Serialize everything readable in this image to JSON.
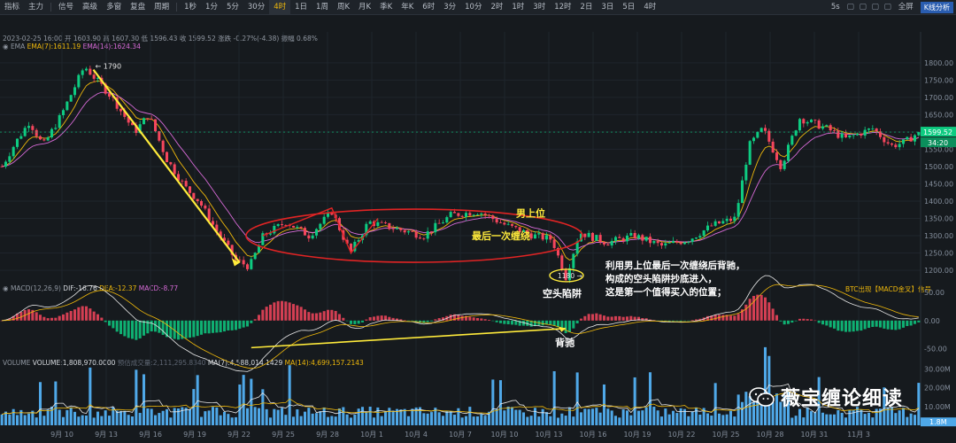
{
  "toolbar": {
    "items": [
      "指标",
      "主力",
      "信号",
      "高级",
      "多窗",
      "复盘",
      "周期",
      "1秒",
      "1分",
      "5分",
      "30分",
      "4时",
      "1日",
      "1周",
      "周K",
      "月K",
      "季K",
      "年K",
      "6时",
      "3分",
      "10分",
      "2时",
      "1时",
      "3时",
      "12时",
      "2日",
      "3日",
      "5日",
      "4时"
    ],
    "active_index": 11,
    "speed": "5s",
    "fullscreen": "全屏",
    "kline_analysis": "K线分析"
  },
  "info": {
    "ohlc": "2023-02-25 16:00  开 1603.90  高 1607.30  低 1596.43  收 1599.52  涨跌 -0.27%(-4.38)  振幅 0.68%",
    "ema_name": "EMA",
    "ema7": "EMA(7):1611.19",
    "ema14": "EMA(14):1624.34",
    "macd_name": "MACD(12,26,9)",
    "dif": "DIF:-16.76",
    "dea": "DEA:-12.37",
    "macd": "MACD:-8.77",
    "volume_name": "VOLUME",
    "volume_val": "VOLUME:1,808,970.0000",
    "volume_est": "预估成交量:2,111,295.8340",
    "vol_ma7": "MA(7):4,588,014.1429",
    "vol_ma14": "MA(14):4,699,157.2143",
    "macd_right": "BTC出现【MACD金叉】信号"
  },
  "colors": {
    "bg": "#161a1e",
    "up": "#0ecb81",
    "down": "#f6465d",
    "annot": "#ffeb3b",
    "ellipse": "#e02424",
    "ema7": "#f0b90b",
    "ema14": "#d66ad6",
    "volume": "#4fa8e8"
  },
  "chart_data": {
    "type": "candlestick",
    "symbol": "BTC",
    "x_tick_labels": [
      "9月 10",
      "9月 13",
      "9月 16",
      "9月 19",
      "9月 22",
      "9月 25",
      "9月 28",
      "10月 1",
      "10月 4",
      "10月 7",
      "10月 10",
      "10月 13",
      "10月 16",
      "10月 19",
      "10月 22",
      "10月 25",
      "10月 28",
      "10月 31",
      "11月 3"
    ],
    "price_axis": {
      "ticks": [
        1800,
        1750,
        1700,
        1650,
        1600,
        1550,
        1500,
        1450,
        1400,
        1350,
        1300,
        1250,
        1200
      ],
      "ylim": [
        1172,
        1838
      ]
    },
    "price_path": [
      [
        0,
        1500
      ],
      [
        0.015,
        1570
      ],
      [
        0.03,
        1630
      ],
      [
        0.045,
        1560
      ],
      [
        0.065,
        1650
      ],
      [
        0.09,
        1790
      ],
      [
        0.12,
        1700
      ],
      [
        0.145,
        1600
      ],
      [
        0.16,
        1650
      ],
      [
        0.18,
        1520
      ],
      [
        0.2,
        1440
      ],
      [
        0.215,
        1400
      ],
      [
        0.235,
        1310
      ],
      [
        0.255,
        1230
      ],
      [
        0.27,
        1210
      ],
      [
        0.285,
        1300
      ],
      [
        0.31,
        1340
      ],
      [
        0.335,
        1300
      ],
      [
        0.36,
        1370
      ],
      [
        0.38,
        1250
      ],
      [
        0.4,
        1340
      ],
      [
        0.43,
        1320
      ],
      [
        0.46,
        1300
      ],
      [
        0.49,
        1360
      ],
      [
        0.52,
        1370
      ],
      [
        0.55,
        1330
      ],
      [
        0.58,
        1300
      ],
      [
        0.6,
        1290
      ],
      [
        0.615,
        1180
      ],
      [
        0.63,
        1310
      ],
      [
        0.66,
        1280
      ],
      [
        0.69,
        1300
      ],
      [
        0.72,
        1270
      ],
      [
        0.75,
        1290
      ],
      [
        0.775,
        1330
      ],
      [
        0.8,
        1350
      ],
      [
        0.815,
        1560
      ],
      [
        0.83,
        1610
      ],
      [
        0.85,
        1500
      ],
      [
        0.87,
        1640
      ],
      [
        0.9,
        1610
      ],
      [
        0.92,
        1580
      ],
      [
        0.95,
        1610
      ],
      [
        0.97,
        1560
      ],
      [
        0.985,
        1570
      ],
      [
        1.0,
        1599.52
      ]
    ],
    "annotations": {
      "high_label": "1790",
      "low_label": "1180",
      "current_price": "1599.52",
      "countdown": "34:20",
      "male_upper": "男上位",
      "last_entanglement": "最后一次缠绕",
      "short_trap": "空头陷阱",
      "divergence": "背驰",
      "note_line1": "利用男上位最后一次缠绕后背驰，",
      "note_line2": "构成的空头陷阱抄底进入，",
      "note_line3": "这是第一个值得买入的位置；"
    },
    "macd_axis": {
      "ticks": [
        "50.00",
        "0.00",
        "-50.00"
      ],
      "ylim": [
        -60,
        50
      ]
    },
    "volume_axis": {
      "ticks": [
        "30.00M",
        "20.00M",
        "10.00M"
      ],
      "last_volume": "1.8M"
    },
    "series": [
      {
        "name": "EMA(7)",
        "last": 1611.19
      },
      {
        "name": "EMA(14)",
        "last": 1624.34
      }
    ]
  },
  "watermark": "薇宝缠论细读"
}
